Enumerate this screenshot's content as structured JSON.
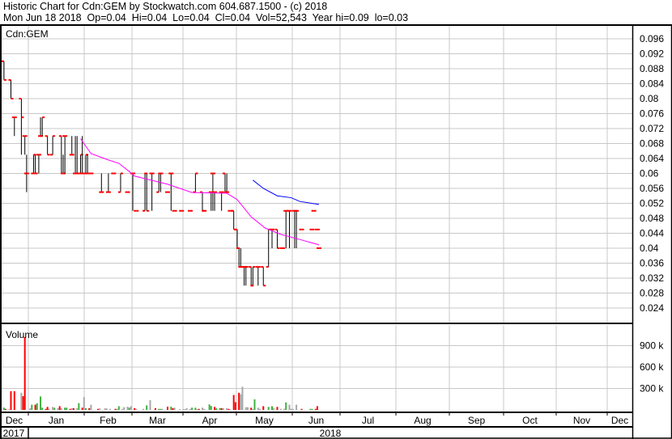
{
  "header": {
    "line1": "Historic Chart for Cdn:GEM by Stockwatch.com 604.687.1500 - (c) 2018",
    "line2": "Mon Jun 18 2018  Op=0.04  Hi=0.04  Lo=0.04  Cl=0.04  Vol=52,543  Year hi=0.09  lo=0.03"
  },
  "colors": {
    "up": "#40b040",
    "down": "#ff0000",
    "flat": "#a8a8a8",
    "ohlc": "#000000",
    "tick": "#ff0000",
    "ma_short": "#ff00ff",
    "ma_long": "#0000ff",
    "grid": "#c8c8c8"
  },
  "chart_data": {
    "type": "ohlc",
    "symbol_label": "Cdn:GEM",
    "x_unit": "days since 2018-01-01",
    "price_axis": {
      "ticks": [
        "0.096",
        "0.092",
        "0.088",
        "0.084",
        "0.08",
        "0.076",
        "0.072",
        "0.068",
        "0.064",
        "0.06",
        "0.056",
        "0.052",
        "0.048",
        "0.044",
        "0.04",
        "0.036",
        "0.032",
        "0.028",
        "0.024"
      ],
      "ylim": [
        0.0205,
        0.0995
      ]
    },
    "bars": [
      [
        -14,
        0.09,
        0.09,
        0.085,
        0.085
      ],
      [
        -10,
        0.085,
        0.085,
        0.08,
        0.08
      ],
      [
        -8,
        0.075,
        0.075,
        0.07,
        0.075
      ],
      [
        -4,
        0.08,
        0.08,
        0.065,
        0.075
      ],
      [
        -2,
        0.07,
        0.07,
        0.065,
        0.07
      ],
      [
        -1,
        0.06,
        0.065,
        0.055,
        0.06
      ],
      [
        3,
        0.06,
        0.065,
        0.06,
        0.065
      ],
      [
        4,
        0.06,
        0.065,
        0.06,
        0.06
      ],
      [
        6,
        0.065,
        0.065,
        0.06,
        0.065
      ],
      [
        7,
        0.07,
        0.075,
        0.07,
        0.07
      ],
      [
        8,
        0.07,
        0.075,
        0.07,
        0.075
      ],
      [
        11,
        0.07,
        0.07,
        0.065,
        0.065
      ],
      [
        14,
        0.065,
        0.07,
        0.065,
        0.07
      ],
      [
        19,
        0.07,
        0.07,
        0.06,
        0.06
      ],
      [
        20,
        0.06,
        0.065,
        0.06,
        0.06
      ],
      [
        21,
        0.07,
        0.07,
        0.06,
        0.07
      ],
      [
        25,
        0.065,
        0.07,
        0.065,
        0.065
      ],
      [
        27,
        0.06,
        0.07,
        0.06,
        0.06
      ],
      [
        28,
        0.06,
        0.07,
        0.06,
        0.06
      ],
      [
        30,
        0.06,
        0.065,
        0.06,
        0.065
      ],
      [
        31,
        0.06,
        0.07,
        0.06,
        0.06
      ],
      [
        33,
        0.06,
        0.065,
        0.06,
        0.065
      ],
      [
        34,
        0.06,
        0.065,
        0.06,
        0.06
      ],
      [
        36,
        0.06,
        0.06,
        0.06,
        0.06
      ],
      [
        42,
        0.055,
        0.06,
        0.055,
        0.055
      ],
      [
        46,
        0.055,
        0.06,
        0.055,
        0.055
      ],
      [
        49,
        0.06,
        0.06,
        0.06,
        0.06
      ],
      [
        53,
        0.055,
        0.06,
        0.055,
        0.06
      ],
      [
        57,
        0.055,
        0.055,
        0.055,
        0.055
      ],
      [
        60,
        0.06,
        0.06,
        0.05,
        0.06
      ],
      [
        62,
        0.05,
        0.05,
        0.05,
        0.05
      ],
      [
        67,
        0.05,
        0.06,
        0.05,
        0.06
      ],
      [
        68,
        0.06,
        0.06,
        0.05,
        0.05
      ],
      [
        71,
        0.06,
        0.06,
        0.05,
        0.06
      ],
      [
        75,
        0.055,
        0.06,
        0.055,
        0.06
      ],
      [
        76,
        0.06,
        0.06,
        0.055,
        0.06
      ],
      [
        80,
        0.055,
        0.055,
        0.055,
        0.055
      ],
      [
        82,
        0.06,
        0.06,
        0.05,
        0.06
      ],
      [
        84,
        0.05,
        0.05,
        0.05,
        0.05
      ],
      [
        88,
        0.05,
        0.05,
        0.05,
        0.05
      ],
      [
        93,
        0.05,
        0.05,
        0.05,
        0.05
      ],
      [
        96,
        0.055,
        0.06,
        0.055,
        0.06
      ],
      [
        100,
        0.055,
        0.055,
        0.05,
        0.05
      ],
      [
        101,
        0.05,
        0.05,
        0.05,
        0.05
      ],
      [
        105,
        0.055,
        0.055,
        0.05,
        0.055
      ],
      [
        106,
        0.06,
        0.06,
        0.05,
        0.06
      ],
      [
        107,
        0.055,
        0.055,
        0.05,
        0.055
      ],
      [
        111,
        0.055,
        0.055,
        0.05,
        0.055
      ],
      [
        113,
        0.06,
        0.06,
        0.055,
        0.055
      ],
      [
        114,
        0.055,
        0.06,
        0.055,
        0.055
      ],
      [
        116,
        0.05,
        0.05,
        0.05,
        0.05
      ],
      [
        118,
        0.05,
        0.05,
        0.045,
        0.045
      ],
      [
        120,
        0.045,
        0.045,
        0.04,
        0.04
      ],
      [
        121,
        0.04,
        0.04,
        0.035,
        0.035
      ],
      [
        122,
        0.035,
        0.04,
        0.035,
        0.035
      ],
      [
        124,
        0.035,
        0.035,
        0.03,
        0.035
      ],
      [
        125,
        0.035,
        0.035,
        0.03,
        0.035
      ],
      [
        128,
        0.035,
        0.035,
        0.03,
        0.03
      ],
      [
        129,
        0.03,
        0.035,
        0.03,
        0.035
      ],
      [
        132,
        0.035,
        0.035,
        0.03,
        0.035
      ],
      [
        135,
        0.035,
        0.035,
        0.03,
        0.03
      ],
      [
        138,
        0.035,
        0.045,
        0.035,
        0.045
      ],
      [
        140,
        0.045,
        0.045,
        0.04,
        0.045
      ],
      [
        143,
        0.045,
        0.045,
        0.04,
        0.04
      ],
      [
        146,
        0.04,
        0.04,
        0.04,
        0.04
      ],
      [
        148,
        0.05,
        0.05,
        0.04,
        0.05
      ],
      [
        150,
        0.05,
        0.05,
        0.04,
        0.05
      ],
      [
        153,
        0.05,
        0.05,
        0.04,
        0.05
      ],
      [
        154,
        0.05,
        0.05,
        0.04,
        0.05
      ],
      [
        157,
        0.045,
        0.045,
        0.045,
        0.045
      ],
      [
        163,
        0.045,
        0.045,
        0.045,
        0.045
      ],
      [
        164,
        0.05,
        0.05,
        0.05,
        0.05
      ],
      [
        166,
        0.045,
        0.045,
        0.045,
        0.045
      ],
      [
        167,
        0.04,
        0.04,
        0.04,
        0.04
      ]
    ],
    "ma_short": [
      [
        30,
        0.0693
      ],
      [
        36,
        0.0653
      ],
      [
        46,
        0.0636
      ],
      [
        52,
        0.0627
      ],
      [
        58,
        0.0605
      ],
      [
        61,
        0.0593
      ],
      [
        80,
        0.0571
      ],
      [
        94,
        0.0549
      ],
      [
        114,
        0.0547
      ],
      [
        120,
        0.053
      ],
      [
        128,
        0.0484
      ],
      [
        136,
        0.0454
      ],
      [
        145,
        0.0437
      ],
      [
        157,
        0.0422
      ],
      [
        167,
        0.0409
      ]
    ],
    "ma_long": [
      [
        129,
        0.0582
      ],
      [
        135,
        0.056
      ],
      [
        143,
        0.054
      ],
      [
        151,
        0.0535
      ],
      [
        156,
        0.0525
      ],
      [
        167,
        0.0517
      ]
    ],
    "volume": {
      "label": "Volume",
      "ticks": [
        "900 k",
        "600 k",
        "300 k"
      ],
      "ylim_k": [
        0,
        1180
      ],
      "bars": [
        [
          -16,
          147,
          "flat"
        ],
        [
          -14,
          31,
          "up"
        ],
        [
          -13,
          14,
          "down"
        ],
        [
          -11,
          10,
          "flat"
        ],
        [
          -10,
          262,
          "down"
        ],
        [
          -8,
          262,
          "down"
        ],
        [
          -4,
          240,
          "flat"
        ],
        [
          -3,
          192,
          "down"
        ],
        [
          -2,
          1020,
          "down"
        ],
        [
          1,
          21,
          "flat"
        ],
        [
          2,
          73,
          "up"
        ],
        [
          4,
          73,
          "down"
        ],
        [
          5,
          94,
          "up"
        ],
        [
          7,
          188,
          "up"
        ],
        [
          8,
          31,
          "up"
        ],
        [
          10,
          14,
          "down"
        ],
        [
          11,
          42,
          "down"
        ],
        [
          12,
          14,
          "flat"
        ],
        [
          14,
          42,
          "flat"
        ],
        [
          15,
          31,
          "up"
        ],
        [
          17,
          24,
          "flat"
        ],
        [
          18,
          52,
          "down"
        ],
        [
          19,
          24,
          "flat"
        ],
        [
          21,
          31,
          "up"
        ],
        [
          22,
          31,
          "up"
        ],
        [
          24,
          14,
          "down"
        ],
        [
          25,
          24,
          "flat"
        ],
        [
          26,
          24,
          "down"
        ],
        [
          28,
          24,
          "flat"
        ],
        [
          29,
          94,
          "up"
        ],
        [
          31,
          31,
          "down"
        ],
        [
          32,
          178,
          "flat"
        ],
        [
          33,
          24,
          "up"
        ],
        [
          35,
          24,
          "down"
        ],
        [
          36,
          73,
          "flat"
        ],
        [
          40,
          14,
          "down"
        ],
        [
          41,
          21,
          "flat"
        ],
        [
          44,
          21,
          "flat"
        ],
        [
          45,
          21,
          "flat"
        ],
        [
          47,
          14,
          "flat"
        ],
        [
          50,
          14,
          "down"
        ],
        [
          51,
          14,
          "flat"
        ],
        [
          52,
          52,
          "up"
        ],
        [
          54,
          14,
          "flat"
        ],
        [
          55,
          38,
          "flat"
        ],
        [
          57,
          45,
          "flat"
        ],
        [
          58,
          31,
          "up"
        ],
        [
          59,
          52,
          "flat"
        ],
        [
          61,
          24,
          "down"
        ],
        [
          62,
          14,
          "flat"
        ],
        [
          66,
          14,
          "flat"
        ],
        [
          68,
          63,
          "up"
        ],
        [
          70,
          136,
          "flat"
        ],
        [
          73,
          24,
          "down"
        ],
        [
          75,
          14,
          "up"
        ],
        [
          76,
          14,
          "up"
        ],
        [
          77,
          14,
          "flat"
        ],
        [
          80,
          45,
          "down"
        ],
        [
          82,
          45,
          "up"
        ],
        [
          83,
          24,
          "down"
        ],
        [
          84,
          31,
          "flat"
        ],
        [
          87,
          10,
          "flat"
        ],
        [
          89,
          10,
          "flat"
        ],
        [
          90,
          10,
          "flat"
        ],
        [
          91,
          24,
          "flat"
        ],
        [
          93,
          14,
          "flat"
        ],
        [
          94,
          31,
          "up"
        ],
        [
          96,
          31,
          "up"
        ],
        [
          97,
          10,
          "flat"
        ],
        [
          98,
          14,
          "down"
        ],
        [
          100,
          31,
          "flat"
        ],
        [
          101,
          14,
          "flat"
        ],
        [
          104,
          77,
          "up"
        ],
        [
          105,
          56,
          "up"
        ],
        [
          107,
          42,
          "down"
        ],
        [
          108,
          24,
          "up"
        ],
        [
          110,
          24,
          "up"
        ],
        [
          111,
          24,
          "down"
        ],
        [
          112,
          24,
          "flat"
        ],
        [
          114,
          24,
          "flat"
        ],
        [
          115,
          14,
          "down"
        ],
        [
          116,
          10,
          "flat"
        ],
        [
          118,
          209,
          "down"
        ],
        [
          119,
          108,
          "down"
        ],
        [
          121,
          240,
          "down"
        ],
        [
          122,
          220,
          "flat"
        ],
        [
          123,
          324,
          "flat"
        ],
        [
          125,
          38,
          "flat"
        ],
        [
          126,
          38,
          "flat"
        ],
        [
          128,
          31,
          "down"
        ],
        [
          129,
          10,
          "flat"
        ],
        [
          130,
          147,
          "up"
        ],
        [
          132,
          31,
          "flat"
        ],
        [
          133,
          14,
          "flat"
        ],
        [
          135,
          52,
          "down"
        ],
        [
          138,
          42,
          "up"
        ],
        [
          140,
          52,
          "up"
        ],
        [
          141,
          24,
          "flat"
        ],
        [
          143,
          42,
          "down"
        ],
        [
          145,
          14,
          "flat"
        ],
        [
          147,
          14,
          "flat"
        ],
        [
          148,
          105,
          "up"
        ],
        [
          150,
          73,
          "flat"
        ],
        [
          151,
          14,
          "flat"
        ],
        [
          152,
          14,
          "flat"
        ],
        [
          154,
          73,
          "flat"
        ],
        [
          157,
          14,
          "down"
        ],
        [
          162,
          14,
          "up"
        ],
        [
          163,
          14,
          "up"
        ],
        [
          165,
          14,
          "down"
        ],
        [
          166,
          52,
          "down"
        ]
      ]
    },
    "x_axis": {
      "months": [
        "Dec",
        "Jan",
        "Feb",
        "Mar",
        "Apr",
        "May",
        "Jun",
        "Jul",
        "Aug",
        "Sep",
        "Oct",
        "Nov",
        "Dec"
      ],
      "years": [
        "2017",
        "2018"
      ]
    }
  }
}
